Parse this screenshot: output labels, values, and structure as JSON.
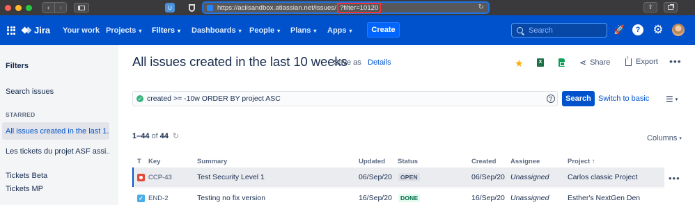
{
  "browser": {
    "url_prefix": "https://aciisandbox.atlassian.net/issues/",
    "url_highlight": "?filter=10120"
  },
  "nav": {
    "product": "Jira",
    "items": [
      {
        "label": "Your work",
        "chevron": false
      },
      {
        "label": "Projects",
        "chevron": true
      },
      {
        "label": "Filters",
        "chevron": true,
        "active": true
      },
      {
        "label": "Dashboards",
        "chevron": true
      },
      {
        "label": "People",
        "chevron": true
      },
      {
        "label": "Plans",
        "chevron": true
      },
      {
        "label": "Apps",
        "chevron": true
      }
    ],
    "create_label": "Create",
    "search_placeholder": "Search",
    "help_glyph": "?"
  },
  "sidebar": {
    "title": "Filters",
    "search_issues": "Search issues",
    "starred_heading": "STARRED",
    "items": [
      {
        "label": "All issues created in the last 1...",
        "selected": true
      },
      {
        "label": "Les tickets du projet ASF assi..."
      },
      {
        "label": "Tickets Beta"
      },
      {
        "label": "Tickets MP"
      }
    ]
  },
  "header": {
    "title": "All issues created in the last 10 weeks",
    "save_as": "Save as",
    "details": "Details",
    "excel_glyph": "X",
    "share": "Share",
    "export": "Export"
  },
  "query": {
    "jql": "created >= -10w ORDER BY project ASC",
    "help_glyph": "?",
    "search_button": "Search",
    "switch_basic": "Switch to basic"
  },
  "results": {
    "range": "1–44",
    "of": "of",
    "total": "44",
    "columns_label": "Columns"
  },
  "table": {
    "headers": {
      "type": "T",
      "key": "Key",
      "summary": "Summary",
      "updated": "Updated",
      "status": "Status",
      "created": "Created",
      "assignee": "Assignee",
      "project": "Project ↑"
    },
    "rows": [
      {
        "type_icon": "bug-icon",
        "key": "CCP-43",
        "summary": "Test Security Level 1",
        "updated": "06/Sep/20",
        "status": "OPEN",
        "created": "06/Sep/20",
        "assignee": "Unassigned",
        "project": "Carlos classic Project"
      },
      {
        "type_icon": "task-icon",
        "key": "END-2",
        "summary": "Testing no fix version",
        "updated": "16/Sep/20",
        "status": "DONE",
        "created": "16/Sep/20",
        "assignee": "Unassigned",
        "project": "Esther's NextGen Den"
      }
    ]
  },
  "colors": {
    "brand": "#0052cc",
    "open_status": "#dfe1e6",
    "done_status": "#e3fcef",
    "star": "#ffab00"
  }
}
